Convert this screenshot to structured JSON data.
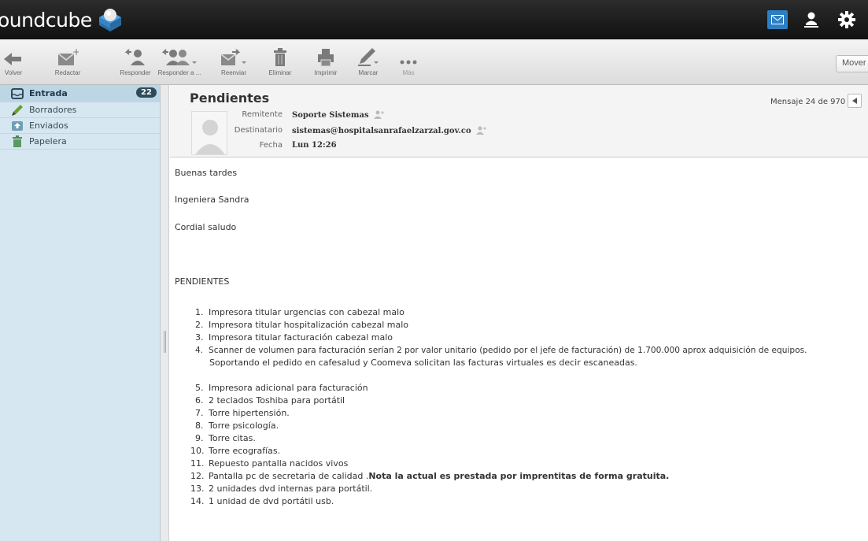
{
  "app": {
    "logo_text": "oundcube"
  },
  "toolbar": {
    "back": "Volver",
    "compose": "Redactar",
    "reply": "Responder",
    "reply_all": "Responder a ...",
    "forward": "Reenviar",
    "delete": "Eliminar",
    "print": "Imprimir",
    "mark": "Marcar",
    "more": "Más",
    "move": "Mover"
  },
  "sidebar": {
    "items": [
      {
        "label": "Entrada",
        "unread": "22"
      },
      {
        "label": "Borradores"
      },
      {
        "label": "Enviados"
      },
      {
        "label": "Papelera"
      }
    ]
  },
  "message": {
    "subject": "Pendientes",
    "from_label": "Remitente",
    "from_value": "Soporte Sistemas",
    "to_label": "Destinatario",
    "to_value": "sistemas@hospitalsanrafaelzarzal.gov.co",
    "date_label": "Fecha",
    "date_value": "Lun 12:26",
    "counter": "Mensaje 24 de 970"
  },
  "body": {
    "greeting": "Buenas tardes",
    "recipient": "Ingeniera Sandra",
    "salutation": "Cordial saludo",
    "heading": "PENDIENTES",
    "items": [
      {
        "num": "1.",
        "text": "Impresora titular urgencias con cabezal malo"
      },
      {
        "num": "2.",
        "text": "Impresora titular hospitalización cabezal malo"
      },
      {
        "num": "3.",
        "text": "Impresora titular facturación cabezal malo"
      },
      {
        "num": "4.",
        "text": "Scanner de volumen para facturación serían 2 por valor unitario (pedido por el jefe de facturación) de 1.700.000 aprox adquisición de equipos.",
        "cont": "Soportando el pedido en cafesalud y Coomeva solicitan las facturas virtuales es decir escaneadas."
      },
      {
        "num": "5.",
        "text": "Impresora adicional para facturación"
      },
      {
        "num": "6.",
        "text": "2 teclados Toshiba para portátil"
      },
      {
        "num": "7.",
        "text": "Torre hipertensión."
      },
      {
        "num": "8.",
        "text": "Torre psicología."
      },
      {
        "num": "9.",
        "text": "Torre citas."
      },
      {
        "num": "10.",
        "text": "Torre ecografías."
      },
      {
        "num": "11.",
        "text": "Repuesto pantalla nacidos vivos"
      },
      {
        "num": "12.",
        "text": "Pantalla pc de secretaria de calidad .",
        "bold": "Nota la actual es prestada por imprentitas de forma gratuita."
      },
      {
        "num": "13.",
        "text": "2 unidades dvd internas para portátil."
      },
      {
        "num": "14.",
        "text": "1 unidad de dvd portátil usb."
      }
    ]
  }
}
